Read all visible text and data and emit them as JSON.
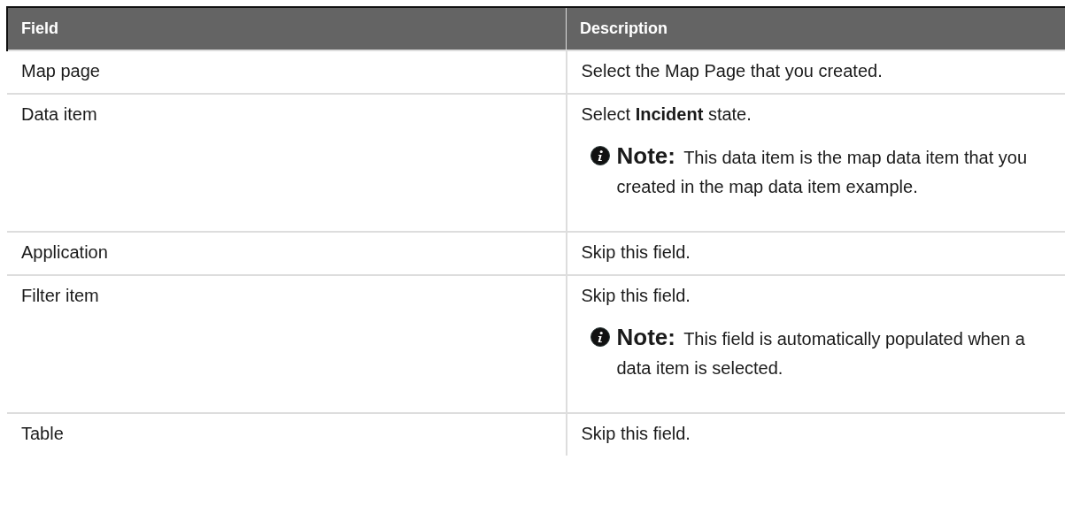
{
  "table": {
    "columns": [
      "Field",
      "Description"
    ],
    "rows": [
      {
        "field": "Map page",
        "description": [
          {
            "kind": "text",
            "text": "Select the Map Page that you created."
          }
        ]
      },
      {
        "field": "Data item",
        "description": [
          {
            "kind": "text",
            "text": "Select **Incident** state."
          },
          {
            "kind": "note",
            "label": "Note:",
            "text": "This data item is the map data item that you created in the map data item example."
          }
        ]
      },
      {
        "field": "Application",
        "description": [
          {
            "kind": "text",
            "text": "Skip this field."
          }
        ]
      },
      {
        "field": "Filter item",
        "description": [
          {
            "kind": "text",
            "text": "Skip this field."
          },
          {
            "kind": "note",
            "label": "Note:",
            "text": "This field is automatically populated when a data item is selected."
          }
        ]
      },
      {
        "field": "Table",
        "description": [
          {
            "kind": "text",
            "text": "Skip this field."
          }
        ]
      }
    ]
  }
}
